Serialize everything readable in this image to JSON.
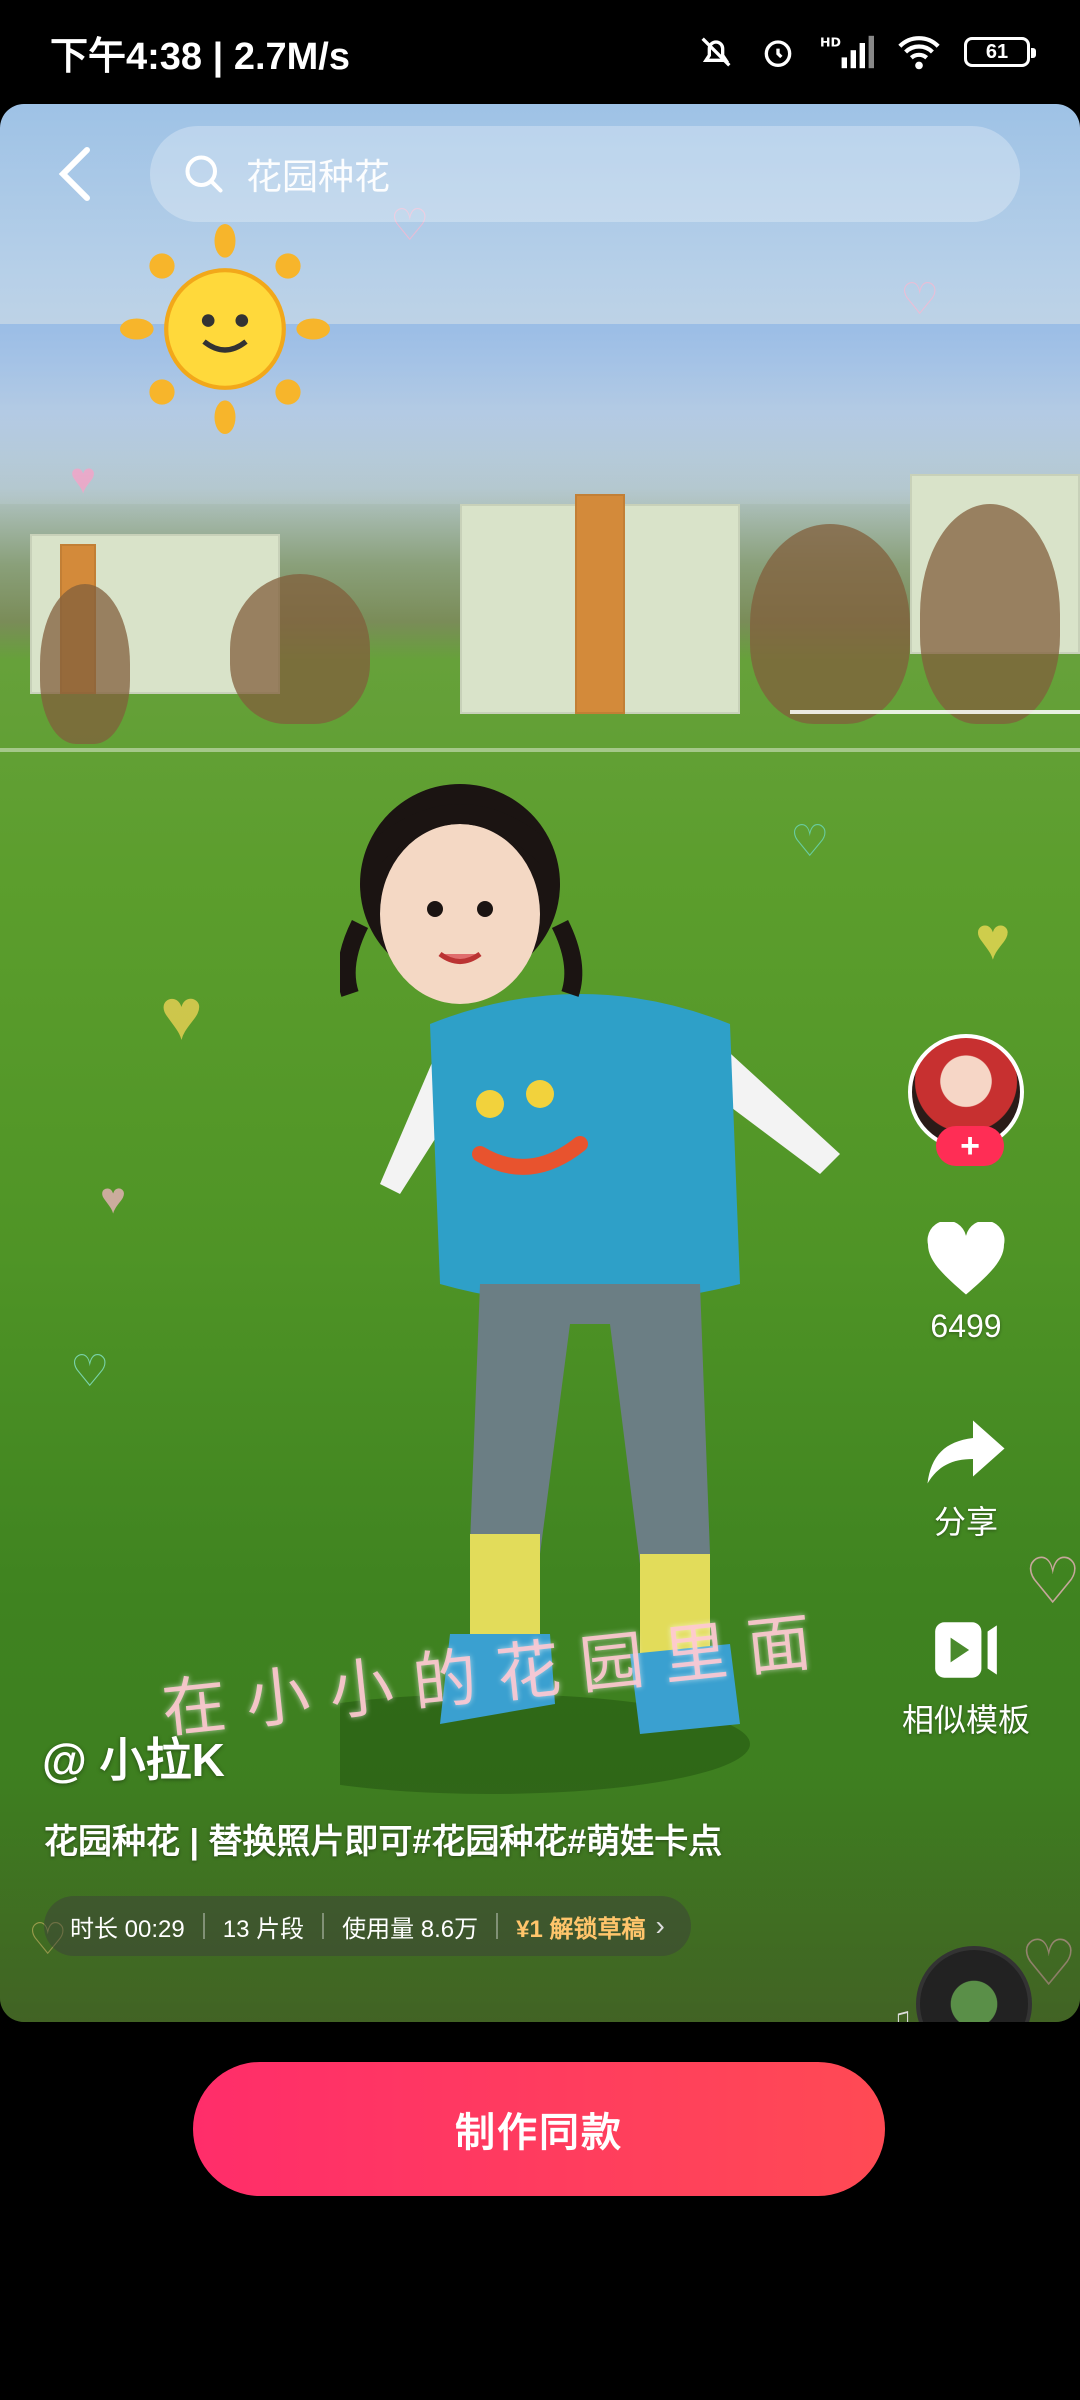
{
  "status_bar": {
    "time": "下午4:38",
    "speed": "2.7M/s",
    "battery": "61",
    "icons": [
      "mute-bell-icon",
      "alarm-icon",
      "hd-signal-icon",
      "wifi-icon",
      "battery-icon"
    ]
  },
  "search": {
    "query": "花园种花"
  },
  "video": {
    "overlay_caption": "在小小的花园里面",
    "author": "@ 小拉K",
    "title": "花园种花 | 替换照片即可#花园种花#萌娃卡点",
    "meta": {
      "duration": "时长 00:29",
      "segments": "13 片段",
      "usage": "使用量 8.6万",
      "unlock": "¥1 解锁草稿"
    }
  },
  "actions": {
    "follow": "+",
    "like_count": "6499",
    "share_label": "分享",
    "similar_label": "相似模板"
  },
  "cta": {
    "make_same": "制作同款"
  }
}
